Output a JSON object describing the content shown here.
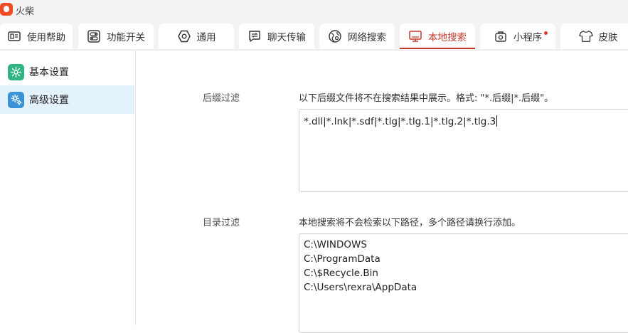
{
  "app": {
    "title": "火柴"
  },
  "tabs": [
    {
      "label": "使用帮助",
      "icon": "help-card-icon"
    },
    {
      "label": "功能开关",
      "icon": "toggle-switch-icon"
    },
    {
      "label": "通用",
      "icon": "hexagon-settings-icon"
    },
    {
      "label": "聊天传输",
      "icon": "chat-transfer-icon"
    },
    {
      "label": "网络搜索",
      "icon": "globe-search-icon"
    },
    {
      "label": "本地搜索",
      "icon": "monitor-icon",
      "active": true
    },
    {
      "label": "小程序",
      "icon": "mini-program-icon",
      "badge": true
    },
    {
      "label": "皮肤",
      "icon": "shirt-icon"
    }
  ],
  "sidebar": {
    "items": [
      {
        "label": "基本设置",
        "icon": "gear-icon",
        "selected": false
      },
      {
        "label": "高级设置",
        "icon": "advanced-gears-icon",
        "selected": true
      }
    ]
  },
  "suffix_filter": {
    "label": "后缀过滤",
    "description": "以下后缀文件将不在搜索结果中展示。格式: \"*.后缀|*.后缀\"。",
    "value": "*.dll|*.lnk|*.sdf|*.tlg|*.tlg.1|*.tlg.2|*.tlg.3"
  },
  "dir_filter": {
    "label": "目录过滤",
    "description": "本地搜索将不会检索以下路径，多个路径请换行添加。",
    "value": "C:\\WINDOWS\nC:\\ProgramData\nC:\\$Recycle.Bin\nC:\\Users\\rexra\\AppData"
  },
  "colors": {
    "accent": "#c0392b",
    "selected_bg": "#e4f2fb",
    "logo": "#f04b23"
  }
}
